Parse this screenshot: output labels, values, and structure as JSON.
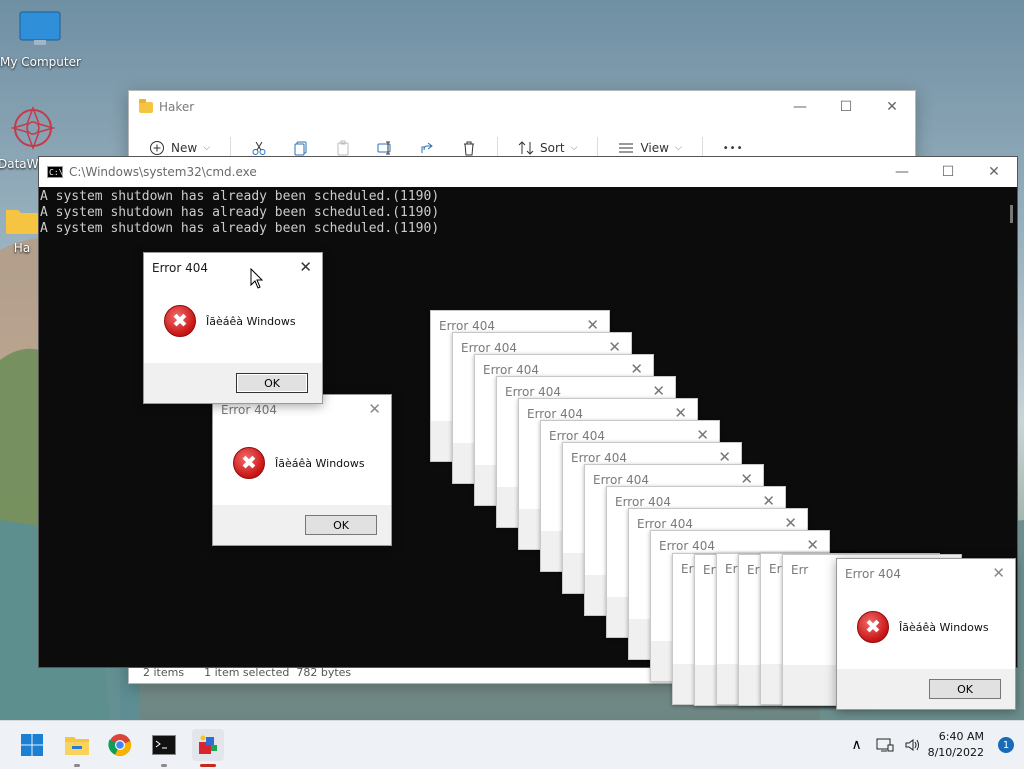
{
  "desktop": {
    "icons": [
      {
        "label": "My Computer"
      },
      {
        "label": "DataW"
      },
      {
        "label": "Ha"
      }
    ]
  },
  "explorer": {
    "title": "Haker",
    "toolbar": {
      "new": "New",
      "sort": "Sort",
      "view": "View",
      "more": "•••"
    },
    "status": {
      "items": "2 items",
      "selected": "1 item selected",
      "size": "782 bytes"
    },
    "controls": {
      "min": "—",
      "max": "☐",
      "close": "✕"
    }
  },
  "cmd": {
    "title": "C:\\Windows\\system32\\cmd.exe",
    "icon_text": "C:\\_",
    "lines": [
      "A system shutdown has already been scheduled.(1190)",
      "A system shutdown has already been scheduled.(1190)",
      "A system shutdown has already been scheduled.(1190)"
    ],
    "controls": {
      "min": "—",
      "max": "☐",
      "close": "✕"
    }
  },
  "dialog": {
    "title": "Error  404",
    "message": "Îãèáêà Windows",
    "ok": "OK",
    "close": "✕",
    "icon_glyph": "✖"
  },
  "stack_titles": [
    "Error  404",
    "Err",
    "Err",
    "Err",
    "Err",
    "Err"
  ],
  "taskbar": {
    "time": "6:40 AM",
    "date": "8/10/2022",
    "notifications": "1",
    "chevron": "∧"
  }
}
